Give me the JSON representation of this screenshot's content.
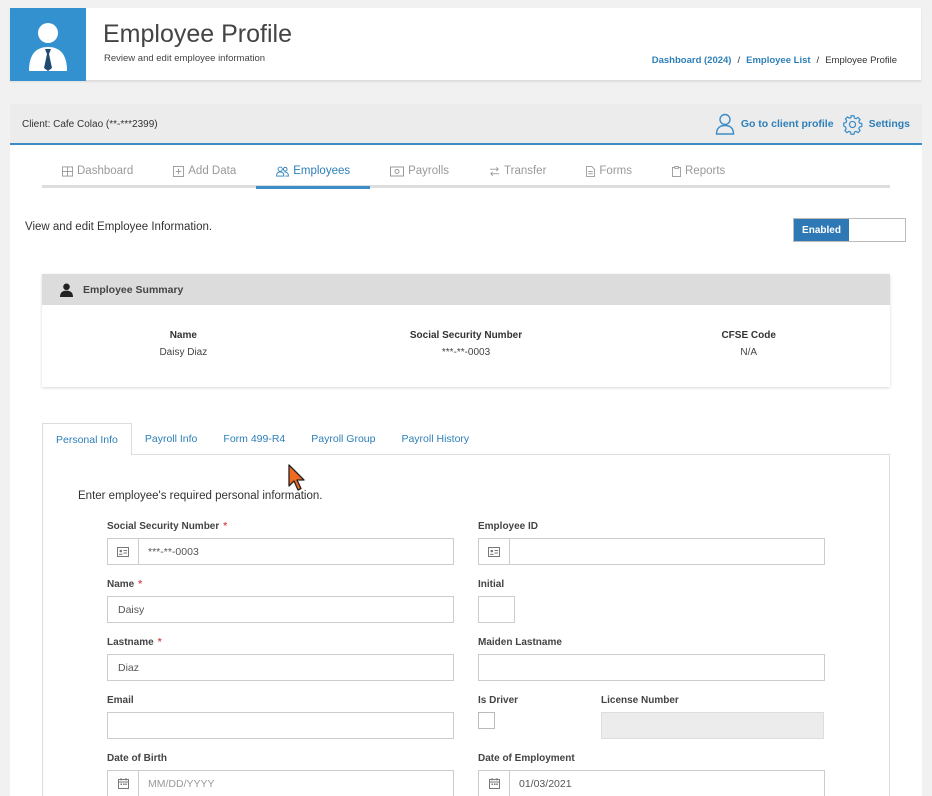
{
  "header": {
    "title": "Employee Profile",
    "subtitle": "Review and edit employee information",
    "breadcrumb": {
      "item1": "Dashboard (2024)",
      "sep1": "/",
      "item2": "Employee List",
      "sep2": "/",
      "current": "Employee Profile"
    }
  },
  "client_bar": {
    "client": "Client: Cafe Colao (**-***2399)",
    "go_to_client_profile": "Go to client profile",
    "settings": "Settings"
  },
  "nav_tabs": [
    {
      "label": "Dashboard",
      "icon": "table-icon"
    },
    {
      "label": "Add Data",
      "icon": "plus-square-icon"
    },
    {
      "label": "Employees",
      "icon": "users-icon"
    },
    {
      "label": "Payrolls",
      "icon": "money-icon"
    },
    {
      "label": "Transfer",
      "icon": "exchange-icon"
    },
    {
      "label": "Forms",
      "icon": "file-icon"
    },
    {
      "label": "Reports",
      "icon": "clipboard-icon"
    }
  ],
  "active_nav_tab": "Employees",
  "intro_text": "View and edit Employee Information.",
  "status_toggle": {
    "label": "Enabled"
  },
  "summary": {
    "title": "Employee Summary",
    "name_label": "Name",
    "name_value": "Daisy Diaz",
    "ssn_label": "Social Security Number",
    "ssn_value": "***-**-0003",
    "cfse_label": "CFSE Code",
    "cfse_value": "N/A"
  },
  "form_tabs": [
    "Personal Info",
    "Payroll Info",
    "Form 499-R4",
    "Payroll Group",
    "Payroll History"
  ],
  "active_form_tab": "Personal Info",
  "form": {
    "intro": "Enter employee's required personal information.",
    "required_mark": "*",
    "ssn_label": "Social Security Number",
    "ssn_value": "***-**-0003",
    "employee_id_label": "Employee ID",
    "employee_id_value": "",
    "name_label": "Name",
    "name_value": "Daisy",
    "initial_label": "Initial",
    "initial_value": "",
    "lastname_label": "Lastname",
    "lastname_value": "Diaz",
    "maiden_label": "Maiden Lastname",
    "maiden_value": "",
    "email_label": "Email",
    "email_value": "",
    "is_driver_label": "Is Driver",
    "license_label": "License Number",
    "license_value": "",
    "dob_label": "Date of Birth",
    "dob_placeholder": "MM/DD/YYYY",
    "doe_label": "Date of Employment",
    "doe_value": "01/03/2021"
  },
  "colors": {
    "accent": "#3a8dc7",
    "link": "#2d7fb8",
    "toggle": "#2e78b5",
    "required": "#d9534f",
    "cursor": "#f26a21"
  }
}
